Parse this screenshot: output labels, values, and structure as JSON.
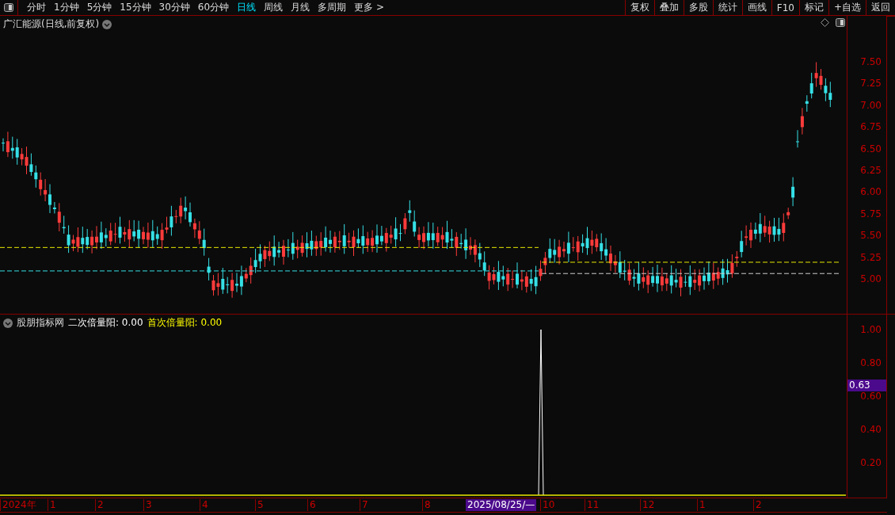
{
  "toolbar": {
    "periods": [
      {
        "label": "分时",
        "selected": false
      },
      {
        "label": "1分钟",
        "selected": false
      },
      {
        "label": "5分钟",
        "selected": false
      },
      {
        "label": "15分钟",
        "selected": false
      },
      {
        "label": "30分钟",
        "selected": false
      },
      {
        "label": "60分钟",
        "selected": false
      },
      {
        "label": "日线",
        "selected": true
      },
      {
        "label": "周线",
        "selected": false
      },
      {
        "label": "月线",
        "selected": false
      },
      {
        "label": "多周期",
        "selected": false
      },
      {
        "label": "更多 >",
        "selected": false
      }
    ],
    "actions": [
      "复权",
      "叠加",
      "多股",
      "统计",
      "画线",
      "F10",
      "标记",
      "+自选",
      "返回"
    ]
  },
  "main_chart": {
    "title": "广汇能源(日线,前复权)",
    "y_ticks": [
      "7.50",
      "7.25",
      "7.00",
      "6.75",
      "6.50",
      "6.25",
      "6.00",
      "5.75",
      "5.50",
      "5.25",
      "5.00"
    ]
  },
  "indicator": {
    "name": "股朋指标网",
    "series": [
      {
        "label": "二次倍量阳: 0.00",
        "color": "#ffffff"
      },
      {
        "label": "首次倍量阳: 0.00",
        "color": "#ffff00"
      }
    ],
    "y_ticks": [
      "1.00",
      "0.80",
      "0.60",
      "0.40",
      "0.20"
    ],
    "cursor_value": "0.63"
  },
  "date_axis": {
    "labels": [
      "2024年",
      "1",
      "2",
      "3",
      "4",
      "5",
      "6",
      "7",
      "8",
      "10",
      "11",
      "12",
      "1",
      "2"
    ],
    "cursor_date": "2025/08/25/—"
  }
}
